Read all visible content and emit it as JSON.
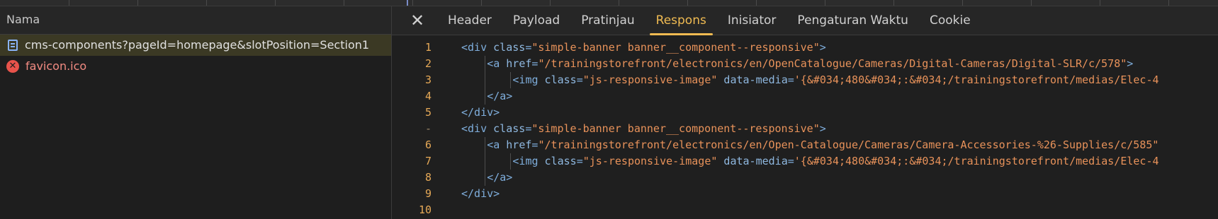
{
  "left_panel": {
    "header": "Nama",
    "requests": [
      {
        "label": "cms-components?pageId=homepage&slotPosition=Section1",
        "icon": "document-icon",
        "selected": true
      },
      {
        "label": "favicon.ico",
        "icon": "error-icon",
        "selected": false
      }
    ]
  },
  "tabs": {
    "close_symbol": "✕",
    "items": [
      {
        "label": "Header"
      },
      {
        "label": "Payload"
      },
      {
        "label": "Pratinjau"
      },
      {
        "label": "Respons",
        "active": true
      },
      {
        "label": "Inisiator"
      },
      {
        "label": "Pengaturan Waktu"
      },
      {
        "label": "Cookie"
      }
    ]
  },
  "code": {
    "lines": [
      {
        "num": "1",
        "parts": [
          [
            "t-tag",
            "<div "
          ],
          [
            "t-attr",
            "class"
          ],
          [
            "t-tag",
            "="
          ],
          [
            "t-val",
            "\"simple-banner banner__component--responsive\""
          ],
          [
            "t-tag",
            ">"
          ]
        ]
      },
      {
        "num": "2",
        "parts": [
          [
            "t-tag",
            "<a "
          ],
          [
            "t-attr",
            "href"
          ],
          [
            "t-tag",
            "="
          ],
          [
            "t-val",
            "\"/trainingstorefront/electronics/en/OpenCatalogue/Cameras/Digital-Cameras/Digital-SLR/c/578\""
          ],
          [
            "t-tag",
            ">"
          ]
        ]
      },
      {
        "num": "3",
        "parts": [
          [
            "t-tag",
            "<img "
          ],
          [
            "t-attr",
            "class"
          ],
          [
            "t-tag",
            "="
          ],
          [
            "t-val",
            "\"js-responsive-image\" "
          ],
          [
            "t-attr",
            "data-media"
          ],
          [
            "t-tag",
            "="
          ],
          [
            "t-val",
            "'{&#034;480&#034;:&#034;/trainingstorefront/medias/Elec-4"
          ]
        ]
      },
      {
        "num": "4",
        "parts": [
          [
            "t-tag",
            "</a>"
          ]
        ]
      },
      {
        "num": "5",
        "parts": [
          [
            "t-tag",
            "</div>"
          ]
        ]
      },
      {
        "num": "-",
        "parts": [
          [
            "t-tag",
            "<div "
          ],
          [
            "t-attr",
            "class"
          ],
          [
            "t-tag",
            "="
          ],
          [
            "t-val",
            "\"simple-banner banner__component--responsive\""
          ],
          [
            "t-tag",
            ">"
          ]
        ]
      },
      {
        "num": "6",
        "parts": [
          [
            "t-tag",
            "<a "
          ],
          [
            "t-attr",
            "href"
          ],
          [
            "t-tag",
            "="
          ],
          [
            "t-val",
            "\"/trainingstorefront/electronics/en/Open-Catalogue/Cameras/Camera-Accessories-%26-Supplies/c/585\""
          ]
        ]
      },
      {
        "num": "7",
        "parts": [
          [
            "t-tag",
            "<img "
          ],
          [
            "t-attr",
            "class"
          ],
          [
            "t-tag",
            "="
          ],
          [
            "t-val",
            "\"js-responsive-image\" "
          ],
          [
            "t-attr",
            "data-media"
          ],
          [
            "t-tag",
            "="
          ],
          [
            "t-val",
            "'{&#034;480&#034;:&#034;/trainingstorefront/medias/Elec-4"
          ]
        ]
      },
      {
        "num": "8",
        "parts": [
          [
            "t-tag",
            "</a>"
          ]
        ]
      },
      {
        "num": "9",
        "parts": [
          [
            "t-tag",
            "</div>"
          ]
        ]
      },
      {
        "num": "10",
        "parts": []
      }
    ]
  }
}
